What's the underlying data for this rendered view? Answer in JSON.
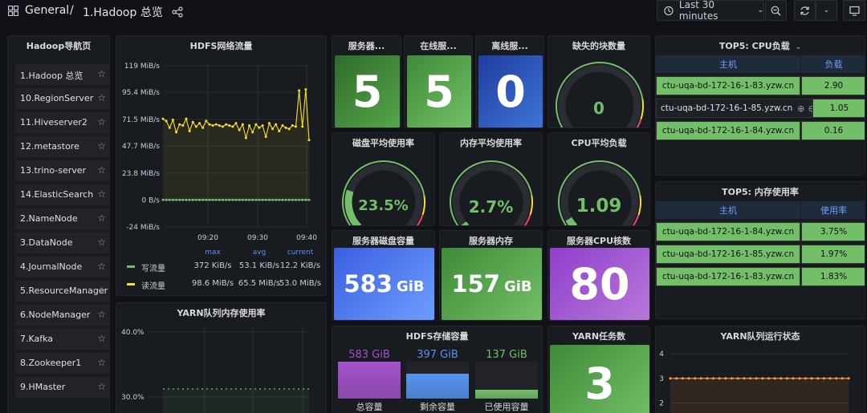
{
  "topbar": {
    "breadcrumb_root": "General",
    "breadcrumb_sep": "/",
    "breadcrumb_page": "1.Hadoop 总览",
    "time_range": "Last 30 minutes"
  },
  "nav": {
    "title": "Hadoop导航页",
    "items": [
      "1.Hadoop 总览",
      "10.RegionServer",
      "11.Hiveserver2",
      "12.metastore",
      "13.trino-server",
      "14.ElasticSearch",
      "2.NameNode",
      "3.DataNode",
      "4.JournalNode",
      "5.ResourceManager",
      "6.NodeManager",
      "7.Kafka",
      "8.Zookeeper1",
      "9.HMaster"
    ]
  },
  "hdfs_traffic": {
    "title": "HDFS网络流量",
    "legend_headers": [
      "max",
      "avg",
      "current"
    ],
    "legend": [
      {
        "name": "写流量",
        "color": "#73bf69",
        "max": "372 KiB/s",
        "avg": "53.1 KiB/s",
        "current": "12.2 KiB/s"
      },
      {
        "name": "读流量",
        "color": "#fade2a",
        "max": "98.6 MiB/s",
        "avg": "65.5 MiB/s",
        "current": "53.0 MiB/s"
      }
    ]
  },
  "yarn_mem": {
    "title": "YARN队列内存使用率",
    "ticks": [
      "40.0%",
      "30.0%"
    ]
  },
  "stats": {
    "servers": {
      "title": "服务器...",
      "value": "5"
    },
    "online": {
      "title": "在线服...",
      "value": "5"
    },
    "offline": {
      "title": "离线服...",
      "value": "0"
    },
    "missing_blocks": {
      "title": "缺失的块数量",
      "value": "0"
    },
    "disk_avg": {
      "title": "磁盘平均使用率",
      "value": "23.5%"
    },
    "mem_avg": {
      "title": "内存平均使用率",
      "value": "2.7%"
    },
    "cpu_avg": {
      "title": "CPU平均负载",
      "value": "1.09"
    },
    "disk_cap": {
      "title": "服务器磁盘容量",
      "value": "583",
      "unit": "GiB"
    },
    "mem_cap": {
      "title": "服务器内存",
      "value": "157",
      "unit": "GiB"
    },
    "cpu_cores": {
      "title": "服务器CPU核数",
      "value": "80"
    },
    "yarn_tasks": {
      "title": "YARN任务数",
      "value": "3"
    }
  },
  "gauge_levels": {
    "missing_blocks": 0.0,
    "disk_avg": 0.235,
    "mem_avg": 0.027,
    "cpu_avg": 0.06
  },
  "hdfs_storage": {
    "title": "HDFS存储容量",
    "bars": [
      {
        "label": "总容量",
        "value": "583 GiB",
        "color": "#a352cc",
        "level": 1.0
      },
      {
        "label": "剩余容量",
        "value": "397 GiB",
        "color": "#5794f2",
        "level": 0.68
      },
      {
        "label": "已使用容量",
        "value": "137 GiB",
        "color": "#73bf69",
        "level": 0.235
      }
    ]
  },
  "cpu_top5": {
    "title": "TOP5: CPU负载",
    "headers": [
      "主机",
      "负载"
    ],
    "rows": [
      {
        "host": "ctu-uqa-bd-172-16-1-83.yzw.cn",
        "value": "2.90"
      },
      {
        "host": "ctu-uqa-bd-172-16-1-85.yzw.cn",
        "value": "1.05"
      },
      {
        "host": "ctu-uqa-bd-172-16-1-84.yzw.cn",
        "value": "0.16"
      }
    ]
  },
  "mem_top5": {
    "title": "TOP5: 内存使用率",
    "headers": [
      "主机",
      "使用率"
    ],
    "rows": [
      {
        "host": "ctu-uqa-bd-172-16-1-84.yzw.cn",
        "value": "3.75%"
      },
      {
        "host": "ctu-uqa-bd-172-16-1-85.yzw.cn",
        "value": "1.97%"
      },
      {
        "host": "ctu-uqa-bd-172-16-1-83.yzw.cn",
        "value": "1.83%"
      }
    ]
  },
  "yarn_queue": {
    "title": "YARN队列运行状态",
    "ticks": [
      "4",
      "3",
      "2"
    ]
  },
  "chart_data": [
    {
      "type": "line",
      "title": "HDFS网络流量",
      "y_ticks": [
        "119 MiB/s",
        "95.4 MiB/s",
        "71.5 MiB/s",
        "47.7 MiB/s",
        "23.8 MiB/s",
        "0 B/s",
        "-24 MiB/s"
      ],
      "ylim": [
        -24,
        119
      ],
      "x_ticks": [
        "09:20",
        "09:30",
        "09:40"
      ],
      "series": [
        {
          "name": "读流量",
          "color": "#fade2a",
          "values": [
            72,
            70,
            64,
            71,
            60,
            67,
            66,
            72,
            61,
            69,
            65,
            68,
            64,
            70,
            67,
            66,
            67,
            66,
            65,
            67,
            66,
            65,
            68,
            62,
            67,
            55,
            66,
            60,
            67,
            64,
            66,
            56,
            68,
            63,
            67,
            61,
            66,
            64,
            63,
            66,
            65,
            97,
            65,
            98,
            53
          ]
        },
        {
          "name": "写流量",
          "color": "#73bf69",
          "values": [
            0,
            0,
            0,
            0,
            0,
            0,
            0,
            0,
            0,
            0,
            0,
            0,
            0,
            0,
            0,
            0,
            0,
            0,
            0,
            0,
            0,
            0,
            0,
            0,
            0,
            0,
            0,
            0,
            0,
            0,
            0,
            0,
            0,
            0,
            0,
            0,
            0,
            0,
            0,
            0,
            0,
            0,
            0,
            0,
            0
          ]
        }
      ]
    },
    {
      "type": "line",
      "title": "YARN队列运行状态",
      "y_ticks": [
        "4",
        "3",
        "2"
      ],
      "ylim": [
        1.2,
        4.2
      ],
      "series": [
        {
          "color": "#ff9830",
          "values": [
            3,
            3,
            3,
            3,
            3,
            3,
            3,
            3,
            3,
            3,
            3,
            3,
            3,
            3,
            3,
            3,
            3,
            3,
            3,
            3,
            3,
            3,
            3,
            3,
            3,
            3,
            3,
            3,
            3,
            3
          ]
        }
      ]
    }
  ]
}
